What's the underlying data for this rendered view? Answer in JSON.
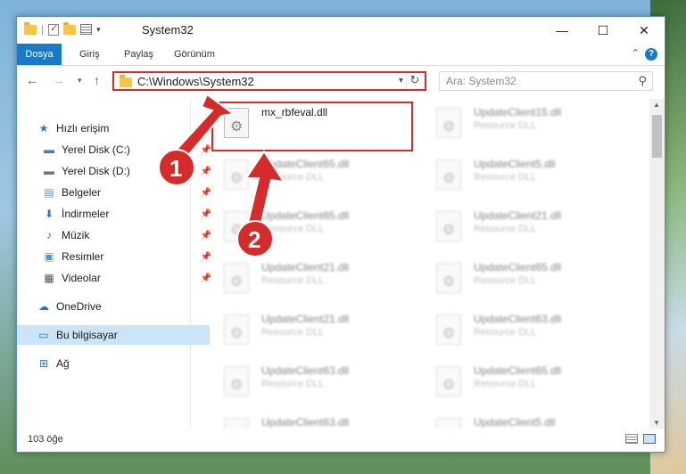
{
  "window": {
    "title": "System32",
    "minimize": "—",
    "maximize": "☐",
    "close": "✕"
  },
  "quick_access_toolbar": {
    "dropdown": "▾",
    "separator": "|"
  },
  "ribbon": {
    "tabs": [
      "Dosya",
      "Giriş",
      "Paylaş",
      "Görünüm"
    ],
    "collapse": "⌃",
    "help": "?"
  },
  "navigation": {
    "back": "←",
    "forward": "→",
    "recent": "▾",
    "up": "↑",
    "address": "C:\\Windows\\System32",
    "address_dropdown": "▾",
    "refresh": "↻",
    "search_placeholder": "Ara: System32",
    "search_icon": "⚲"
  },
  "sidebar": {
    "items": [
      {
        "label": "Hızlı erişim",
        "icon": "star-icon",
        "glyph": "★",
        "color": "#2b78c5",
        "pinned": false
      },
      {
        "label": "Yerel Disk (C:)",
        "icon": "drive-icon",
        "glyph": "▬",
        "color": "#4a7fb5",
        "pinned": true
      },
      {
        "label": "Yerel Disk (D:)",
        "icon": "drive-icon",
        "glyph": "▬",
        "color": "#777777",
        "pinned": true
      },
      {
        "label": "Belgeler",
        "icon": "documents-icon",
        "glyph": "▤",
        "color": "#5a8fc4",
        "pinned": true
      },
      {
        "label": "İndirmeler",
        "icon": "download-icon",
        "glyph": "⬇",
        "color": "#2b78c5",
        "pinned": true
      },
      {
        "label": "Müzik",
        "icon": "music-icon",
        "glyph": "♪",
        "color": "#2b78c5",
        "pinned": true
      },
      {
        "label": "Resimler",
        "icon": "pictures-icon",
        "glyph": "▣",
        "color": "#5a8fc4",
        "pinned": true
      },
      {
        "label": "Videolar",
        "icon": "videos-icon",
        "glyph": "▦",
        "color": "#555555",
        "pinned": true
      },
      {
        "label": "OneDrive",
        "icon": "onedrive-icon",
        "glyph": "☁",
        "color": "#1979ca",
        "pinned": false
      },
      {
        "label": "Bu bilgisayar",
        "icon": "computer-icon",
        "glyph": "▭",
        "color": "#2b78c5",
        "pinned": false
      },
      {
        "label": "Ağ",
        "icon": "network-icon",
        "glyph": "⊞",
        "color": "#2b78c5",
        "pinned": false
      }
    ],
    "pin_glyph": "📌"
  },
  "files": [
    {
      "name": "mx_rbfeval.dll",
      "type": ""
    },
    {
      "name": "UpdateClient15.dll",
      "type": "Resource DLL"
    },
    {
      "name": "UpdateClient65.dll",
      "type": "Resource DLL"
    },
    {
      "name": "UpdateClient5.dll",
      "type": "Resource DLL"
    },
    {
      "name": "UpdateClient65.dll",
      "type": "Resource DLL"
    },
    {
      "name": "UpdateClient21.dll",
      "type": "Resource DLL"
    },
    {
      "name": "UpdateClient21.dll",
      "type": "Resource DLL"
    },
    {
      "name": "UpdateClient65.dll",
      "type": "Resource DLL"
    },
    {
      "name": "UpdateClient21.dll",
      "type": "Resource DLL"
    },
    {
      "name": "UpdateClient63.dll",
      "type": "Resource DLL"
    },
    {
      "name": "UpdateClient63.dll",
      "type": "Resource DLL"
    },
    {
      "name": "UpdateClient65.dll",
      "type": "Resource DLL"
    },
    {
      "name": "UpdateClient63.dll",
      "type": "Resource DLL"
    },
    {
      "name": "UpdateClient5.dll",
      "type": "Resource DLL"
    }
  ],
  "status": {
    "item_count": "103 öğe"
  },
  "scrollbar": {
    "up": "▲",
    "down": "▼"
  },
  "annotations": {
    "step1": "1",
    "step2": "2",
    "color": "#d52b2b"
  }
}
